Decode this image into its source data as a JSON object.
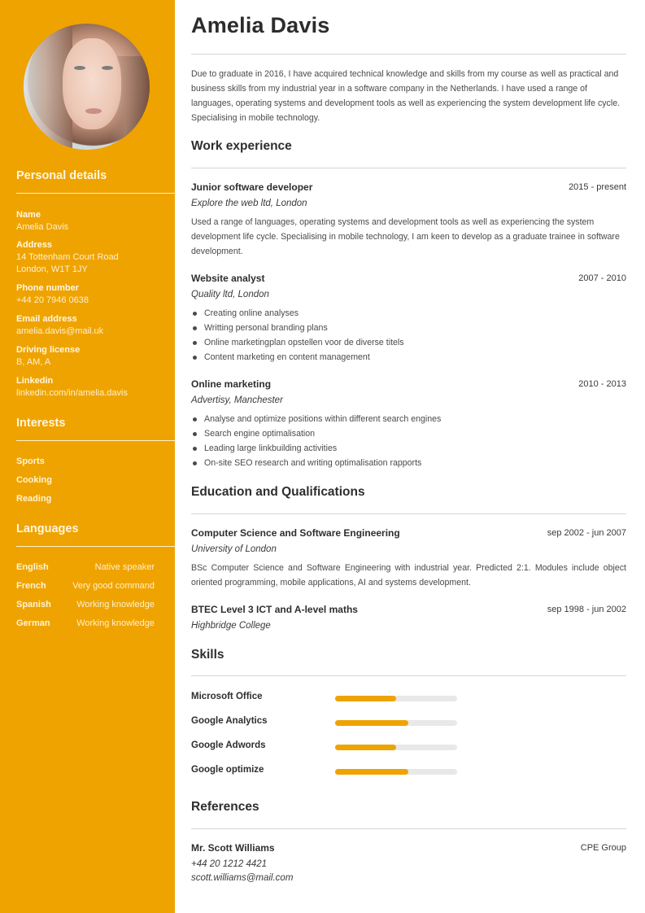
{
  "theme": {
    "accent": "#efa300",
    "skill_track": "#e8e8e8"
  },
  "sidebar": {
    "photo_alt": "Portrait of Amelia Davis",
    "personal_details": {
      "heading": "Personal details",
      "items": [
        {
          "label": "Name",
          "lines": [
            "Amelia Davis"
          ]
        },
        {
          "label": "Address",
          "lines": [
            "14 Tottenham Court Road",
            "London, W1T 1JY"
          ]
        },
        {
          "label": "Phone number",
          "lines": [
            "+44 20 7946 0638"
          ]
        },
        {
          "label": "Email address",
          "lines": [
            "amelia.davis@mail.uk"
          ]
        },
        {
          "label": "Driving license",
          "lines": [
            "B, AM, A"
          ]
        },
        {
          "label": "Linkedin",
          "lines": [
            "linkedin.com/in/amelia.davis"
          ]
        }
      ]
    },
    "interests": {
      "heading": "Interests",
      "items": [
        "Sports",
        "Cooking",
        "Reading"
      ]
    },
    "languages": {
      "heading": "Languages",
      "items": [
        {
          "language": "English",
          "level": "Native speaker"
        },
        {
          "language": "French",
          "level": "Very good command"
        },
        {
          "language": "Spanish",
          "level": "Working knowledge"
        },
        {
          "language": "German",
          "level": "Working knowledge"
        }
      ]
    }
  },
  "main": {
    "name": "Amelia Davis",
    "summary": "Due to graduate in 2016, I have acquired technical knowledge and skills from my course as well as practical and business skills from my industrial year in a software company in the Netherlands. I have used a range of languages, operating systems and development tools as well as experiencing the system development life cycle. Specialising in mobile technology.",
    "work": {
      "heading": "Work experience",
      "entries": [
        {
          "title": "Junior software developer",
          "date": "2015 - present",
          "company": "Explore the web ltd, London",
          "description": "Used a range of languages, operating systems and development tools as well as experiencing the system development life cycle. Specialising in mobile technology, I am keen to develop as a graduate trainee in software development."
        },
        {
          "title": "Website analyst",
          "date": "2007 - 2010",
          "company": "Quality ltd, London",
          "bullets": [
            "Creating online analyses",
            "Writting personal branding plans",
            "Online marketingplan opstellen voor de diverse titels",
            "Content marketing en content management"
          ]
        },
        {
          "title": "Online marketing",
          "date": "2010 - 2013",
          "company": "Advertisy, Manchester",
          "bullets": [
            "Analyse and optimize positions within different search engines",
            "Search engine optimalisation",
            "Leading large linkbuilding activities",
            "On-site SEO research and writing optimalisation rapports"
          ]
        }
      ]
    },
    "education": {
      "heading": "Education and Qualifications",
      "entries": [
        {
          "title": "Computer Science and Software Engineering",
          "date": "sep 2002 - jun 2007",
          "institution": "University of London",
          "description": "BSc Computer Science and Software Engineering with industrial year. Predicted 2:1. Modules include object oriented programming, mobile applications, AI and systems development."
        },
        {
          "title": "BTEC Level 3 ICT and A-level maths",
          "date": "sep 1998 - jun 2002",
          "institution": "Highbridge College"
        }
      ]
    },
    "skills": {
      "heading": "Skills",
      "items": [
        {
          "name": "Microsoft Office",
          "level_percent": 50
        },
        {
          "name": "Google Analytics",
          "level_percent": 60
        },
        {
          "name": "Google Adwords",
          "level_percent": 50
        },
        {
          "name": "Google optimize",
          "level_percent": 60
        }
      ]
    },
    "references": {
      "heading": "References",
      "entries": [
        {
          "name": "Mr. Scott Williams",
          "company": "CPE Group",
          "phone": "+44 20 1212 4421",
          "email": "scott.williams@mail.com"
        }
      ]
    }
  }
}
